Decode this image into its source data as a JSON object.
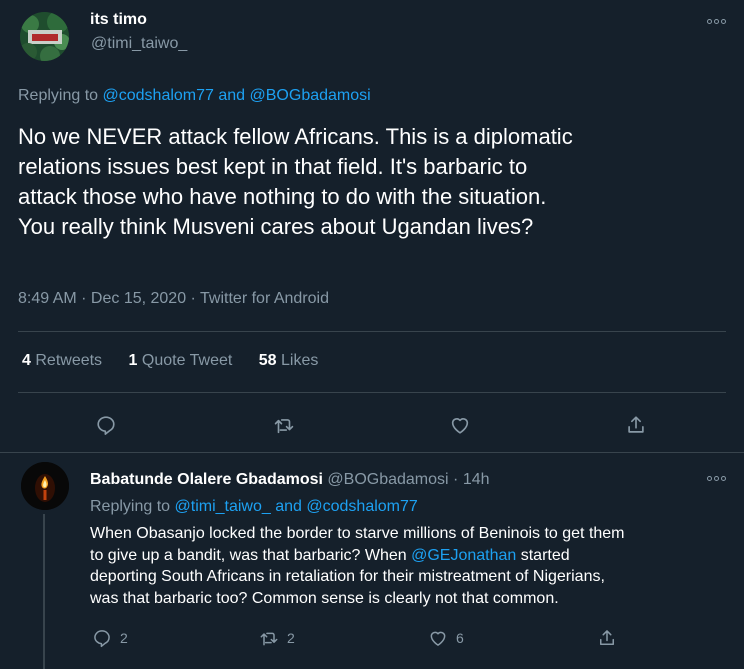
{
  "tweet": {
    "author_name": "its timo",
    "author_handle": "@timi_taiwo_",
    "replying_prefix": "Replying to ",
    "replying_user1": "@codshalom77",
    "replying_and": " and ",
    "replying_user2": "@BOGbadamosi",
    "text": "No we NEVER attack fellow Africans. This is a diplomatic\nrelations issues best kept in that field. It's barbaric to\nattack those who have nothing to do with the situation.\nYou really think Musveni cares about Ugandan lives?",
    "meta": "8:49 AM · Dec 15, 2020 · Twitter for Android",
    "stats": {
      "retweets_count": "4",
      "retweets_label": "Retweets",
      "quotes_count": "1",
      "quotes_label": "Quote Tweet",
      "likes_count": "58",
      "likes_label": "Likes"
    },
    "actions": [
      "reply-icon",
      "retweet-icon",
      "like-icon",
      "share-icon"
    ]
  },
  "reply": {
    "author_name": "Babatunde Olalere Gbadamosi",
    "author_handle": "@BOGbadamosi",
    "time": " · 14h",
    "replying_prefix": "Replying to ",
    "replying_user1": "@timi_taiwo_",
    "replying_and": " and ",
    "replying_user2": "@codshalom77",
    "line1": "When Obasanjo locked the border to starve millions of Beninois to get them",
    "line2": "to give up a bandit, was that barbaric? When ",
    "mention": "@GEJonathan",
    "line2_end": " started",
    "line3": "deporting South Africans in retaliation for their mistreatment of Nigerians,",
    "line4": "was that barbaric too? Common sense is clearly not that common.",
    "reply_count": "2",
    "retweet_count": "2",
    "like_count": "6"
  },
  "colors": {
    "background": "#15202b",
    "secondary_text": "#8899a6",
    "link": "#1da1f2",
    "divider": "#38444d"
  }
}
